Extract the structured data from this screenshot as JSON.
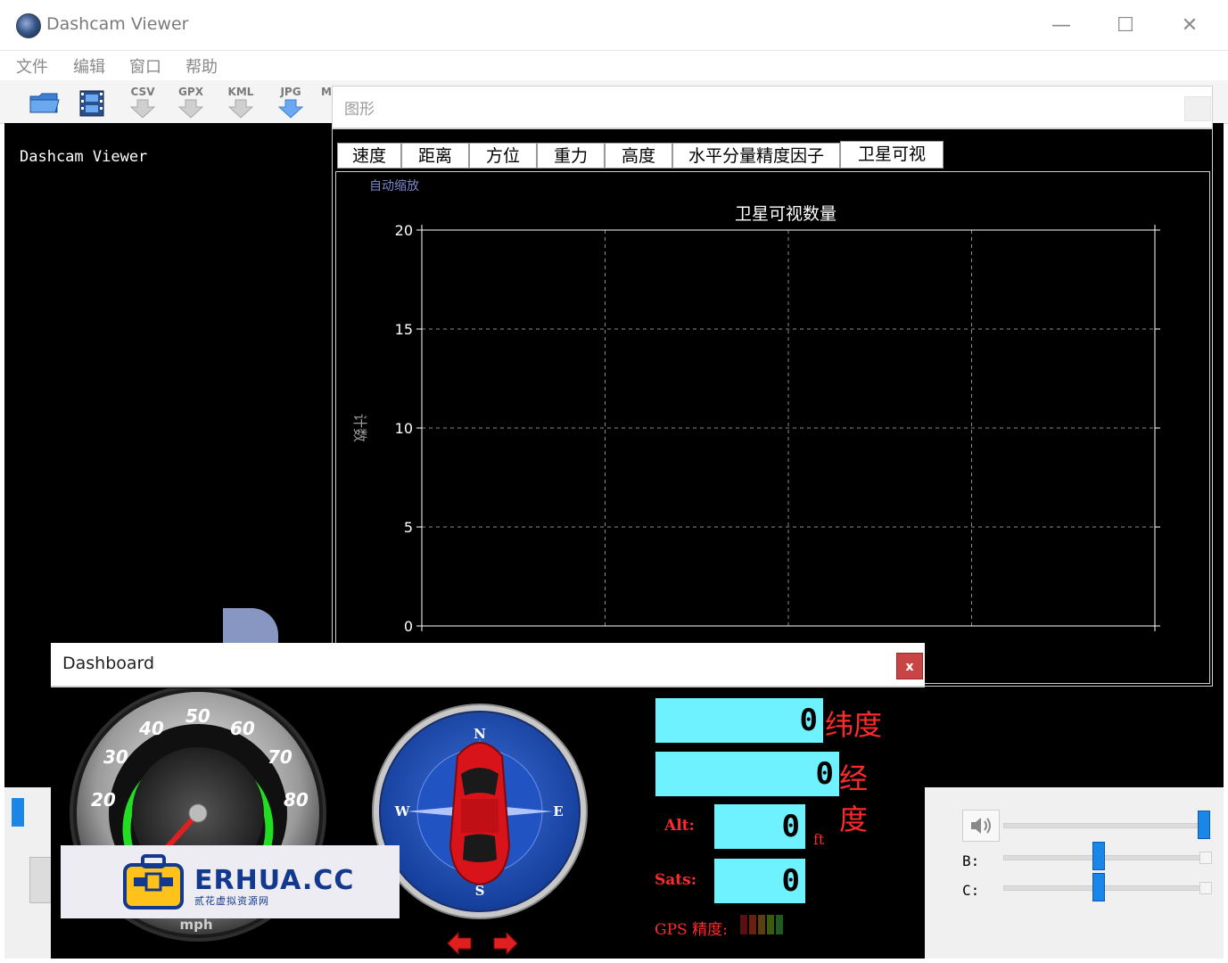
{
  "window": {
    "title": "Dashcam Viewer",
    "minimize": "—",
    "maximize": "☐",
    "close": "✕"
  },
  "menu": [
    "文件",
    "编辑",
    "窗口",
    "帮助"
  ],
  "toolbar": [
    "CSV",
    "GPX",
    "KML",
    "JPG",
    "M"
  ],
  "left": {
    "title": "Dashcam Viewer"
  },
  "graph": {
    "panel_title": "图形",
    "tabs": [
      "速度",
      "距离",
      "方位",
      "重力",
      "高度",
      "水平分量精度因子",
      "卫星可视"
    ],
    "active_tab": 6,
    "auto_zoom": "自动缩放"
  },
  "chart_data": {
    "type": "line",
    "title": "卫星可视数量",
    "ylabel": "计数",
    "xlabel": "",
    "ylim": [
      0,
      20
    ],
    "yticks": [
      0,
      5,
      10,
      15,
      20
    ],
    "x_divisions": 4,
    "grid": true,
    "series": []
  },
  "dashboard": {
    "title": "Dashboard",
    "close": "x",
    "speedo": {
      "ticks": [
        "20",
        "30",
        "40",
        "50",
        "60",
        "70",
        "80"
      ],
      "unit": "mph",
      "value": 0
    },
    "compass": {
      "N": "N",
      "S": "S",
      "E": "E",
      "W": "W"
    },
    "lat": {
      "value": "0",
      "label": "纬度"
    },
    "lon": {
      "value": "0",
      "label": "经度"
    },
    "alt": {
      "label": "Alt:",
      "value": "0",
      "unit": "ft"
    },
    "sats": {
      "label": "Sats:",
      "value": "0"
    },
    "gps_accuracy": "GPS 精度:"
  },
  "controls": {
    "b_label": "B:",
    "c_label": "C:"
  },
  "watermark": {
    "brand": "ERHUA.CC",
    "sub": "贰花虚拟资源网"
  },
  "colors": {
    "lcd": "#6ef2ff",
    "red": "#ff2a2a",
    "slider": "#1a86e8",
    "close_red": "#c94545"
  }
}
